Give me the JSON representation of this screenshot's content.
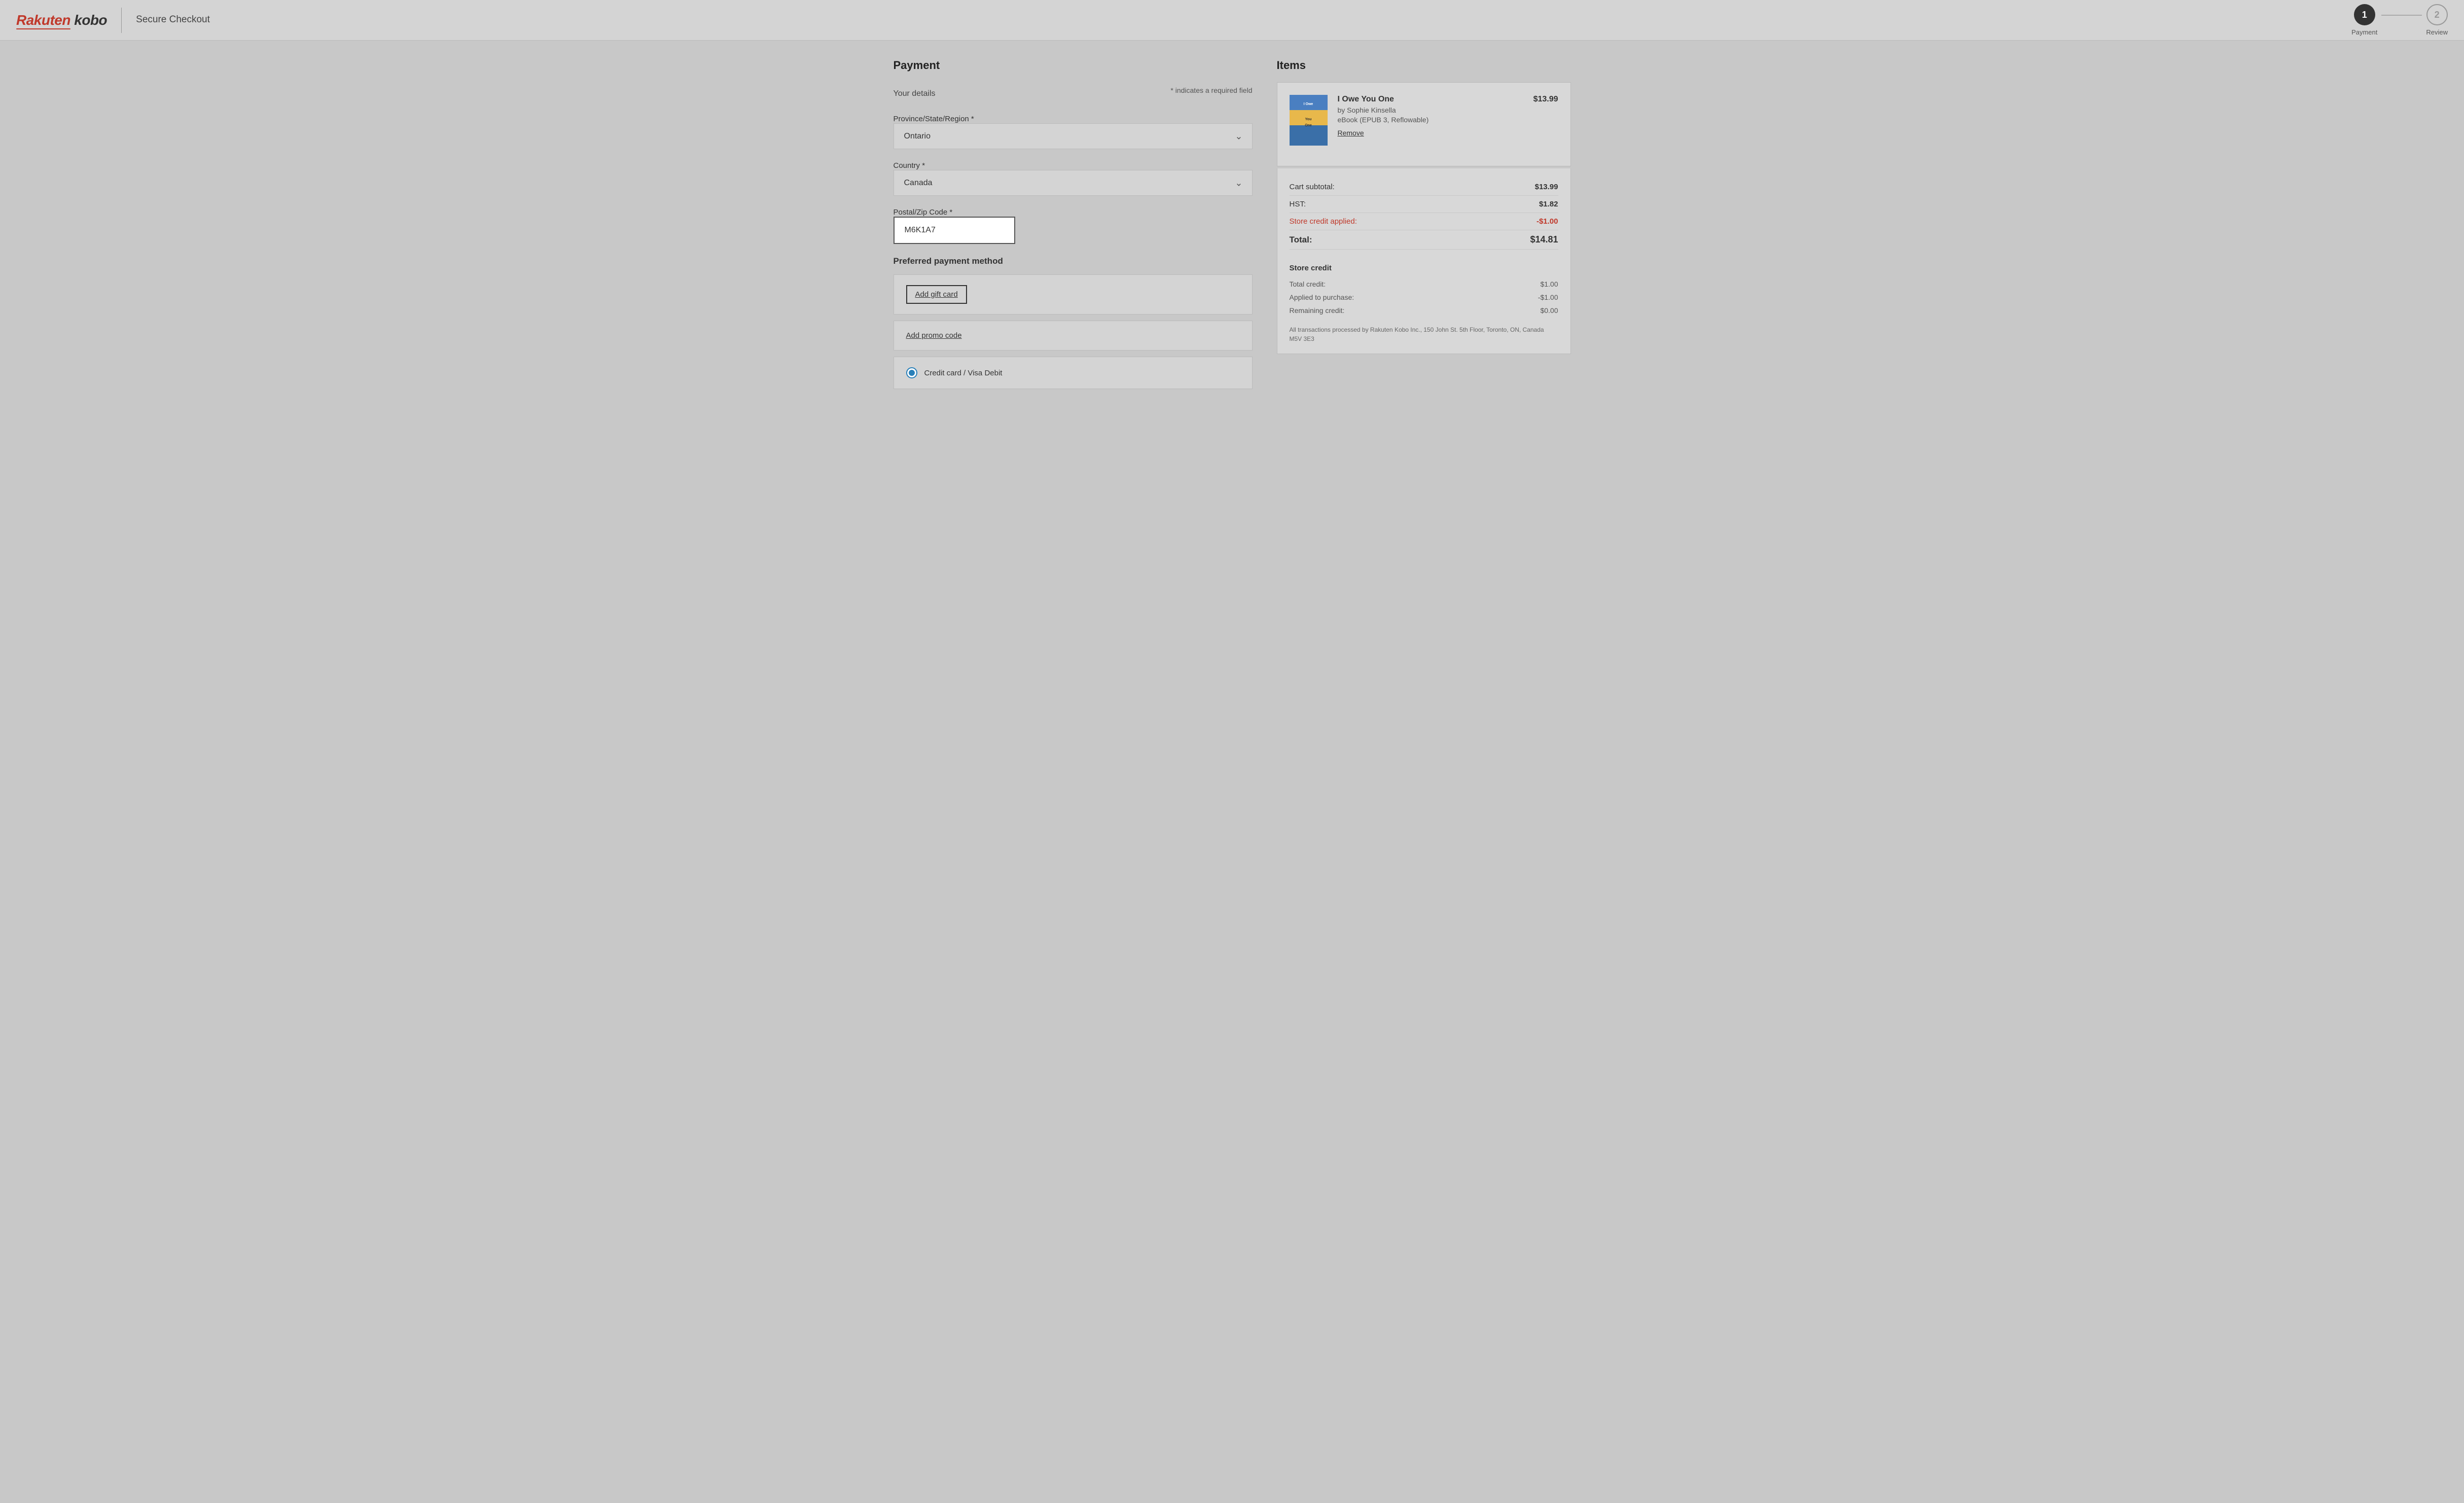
{
  "header": {
    "logo_rakuten": "Rakuten",
    "logo_kobo": "kobo",
    "checkout_title": "Secure Checkout",
    "steps": [
      {
        "number": "1",
        "label": "Payment",
        "active": true
      },
      {
        "number": "2",
        "label": "Review",
        "active": false
      }
    ]
  },
  "payment": {
    "section_title": "Payment",
    "your_details_label": "Your details",
    "required_note": "* indicates a required field",
    "province_label": "Province/State/Region *",
    "province_value": "Ontario",
    "country_label": "Country *",
    "country_value": "Canada",
    "postal_label": "Postal/Zip Code *",
    "postal_value": "M6K1A7",
    "preferred_payment_label": "Preferred payment method",
    "add_gift_card_label": "Add gift card",
    "add_promo_label": "Add promo code",
    "credit_card_label": "Credit card / Visa Debit"
  },
  "items": {
    "section_title": "Items",
    "book": {
      "title": "I Owe You One",
      "author": "by Sophie Kinsella",
      "format": "eBook (EPUB 3, Reflowable)",
      "price": "$13.99",
      "remove_label": "Remove"
    },
    "cart_subtotal_label": "Cart subtotal:",
    "cart_subtotal_value": "$13.99",
    "hst_label": "HST:",
    "hst_value": "$1.82",
    "store_credit_applied_label": "Store credit applied:",
    "store_credit_applied_value": "-$1.00",
    "total_label": "Total:",
    "total_value": "$14.81",
    "store_credit": {
      "title": "Store credit",
      "total_credit_label": "Total credit:",
      "total_credit_value": "$1.00",
      "applied_label": "Applied to purchase:",
      "applied_value": "-$1.00",
      "remaining_label": "Remaining credit:",
      "remaining_value": "$0.00"
    },
    "transaction_note": "All transactions processed by Rakuten Kobo Inc., 150 John St. 5th Floor, Toronto, ON, Canada M5V 3E3"
  }
}
